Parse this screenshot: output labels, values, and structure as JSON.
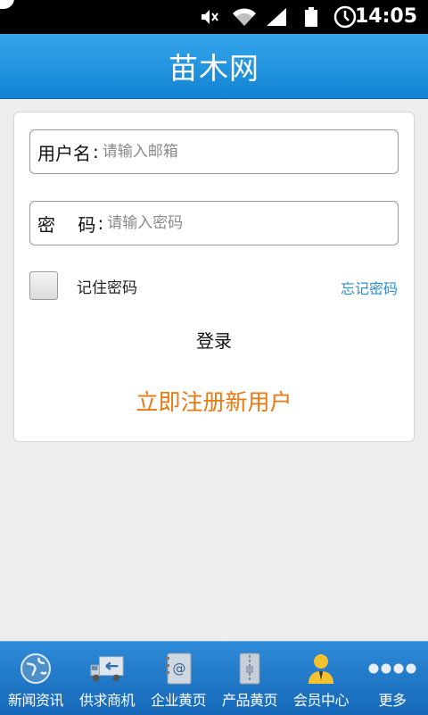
{
  "status_bar": {
    "time": "14:05"
  },
  "header": {
    "title": "苗木网"
  },
  "login": {
    "username_label": "用户名",
    "username_placeholder": "请输入邮箱",
    "password_label": "密    码",
    "password_placeholder": "请输入密码",
    "colon": ":",
    "remember_label": "记住密码",
    "forgot_label": "忘记密码",
    "login_label": "登录",
    "register_label": "立即注册新用户"
  },
  "bottom_nav": [
    {
      "label": "新闻资讯",
      "icon": "globe-icon"
    },
    {
      "label": "供求商机",
      "icon": "truck-icon"
    },
    {
      "label": "企业黄页",
      "icon": "contact-book-icon"
    },
    {
      "label": "产品黄页",
      "icon": "folder-icon"
    },
    {
      "label": "会员中心",
      "icon": "member-icon"
    },
    {
      "label": "更多",
      "icon": "more-icon"
    }
  ],
  "colors": {
    "title_bar": "#1e93e0",
    "nav_bar": "#1b74c5",
    "register_text": "#e8780f",
    "forgot_text": "#2a8fd1"
  }
}
